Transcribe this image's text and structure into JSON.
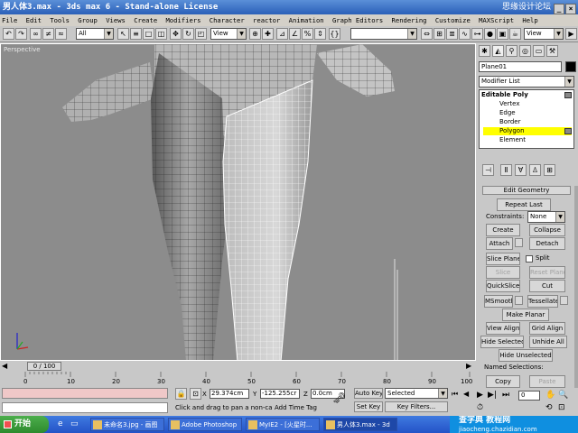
{
  "window": {
    "title": "男人体3.max - 3ds max 6 - Stand-alone License",
    "watermark": "思缘设计论坛"
  },
  "menu": [
    "File",
    "Edit",
    "Tools",
    "Group",
    "Views",
    "Create",
    "Modifiers",
    "Character",
    "reactor",
    "Animation",
    "Graph Editors",
    "Rendering",
    "Customize",
    "MAXScript",
    "Help"
  ],
  "toolbar": {
    "selection_filter": "All",
    "ref_coord": "View",
    "named_sel": "",
    "ref_coord2": "View"
  },
  "viewport": {
    "label": "Perspective"
  },
  "panel": {
    "object_name": "Plane01",
    "modifier_list": "Modifier List",
    "stack": [
      "Editable Poly",
      "Vertex",
      "Edge",
      "Border",
      "Polygon",
      "Element"
    ],
    "rollout_title": "Edit Geometry",
    "repeat_last": "Repeat Last",
    "constraints_label": "Constraints:",
    "constraints_value": "None",
    "buttons": {
      "create": "Create",
      "collapse": "Collapse",
      "attach": "Attach",
      "detach": "Detach",
      "slice_plane": "Slice Plane",
      "split": "Split",
      "slice": "Slice",
      "reset_plane": "Reset Plane",
      "quickslice": "QuickSlice",
      "cut": "Cut",
      "msmooth": "MSmooth",
      "tessellate": "Tessellate",
      "make_planar": "Make Planar",
      "view_align": "View Align",
      "grid_align": "Grid Align",
      "hide_selected": "Hide Selected",
      "unhide_all": "Unhide All",
      "hide_unselected": "Hide Unselected",
      "named_selections": "Named Selections:",
      "copy": "Copy",
      "paste": "Paste"
    }
  },
  "timeline": {
    "frame": "0 / 100",
    "ticks": [
      "0",
      "10",
      "20",
      "30",
      "40",
      "50",
      "60",
      "70",
      "80",
      "90",
      "100"
    ]
  },
  "status": {
    "x_label": "X",
    "x": "29.374cm",
    "y_label": "Y",
    "y": "-125.255cr",
    "z_label": "Z",
    "z": "0.0cm",
    "prompt": "Click and drag to pan a non-camer",
    "add_time_tag": "Add Time Tag",
    "auto_key": "Auto Key",
    "selected": "Selected",
    "set_key": "Set Key",
    "key_filters": "Key Filters...",
    "frame_spinner": "0"
  },
  "taskbar": {
    "start": "开始",
    "tasks": [
      "未命名3.jpg - 画图",
      "Adobe Photoshop",
      "MyIE2 - [火星时...",
      "男人体3.max - 3d"
    ],
    "tray": "jiaocheng.chazidian.com",
    "watermark": "查字典 教程网"
  },
  "colors": {
    "accent_selected": "#ffff00",
    "title_blue": "#2a5fb8",
    "viewport_bg": "#8c8c8c"
  }
}
